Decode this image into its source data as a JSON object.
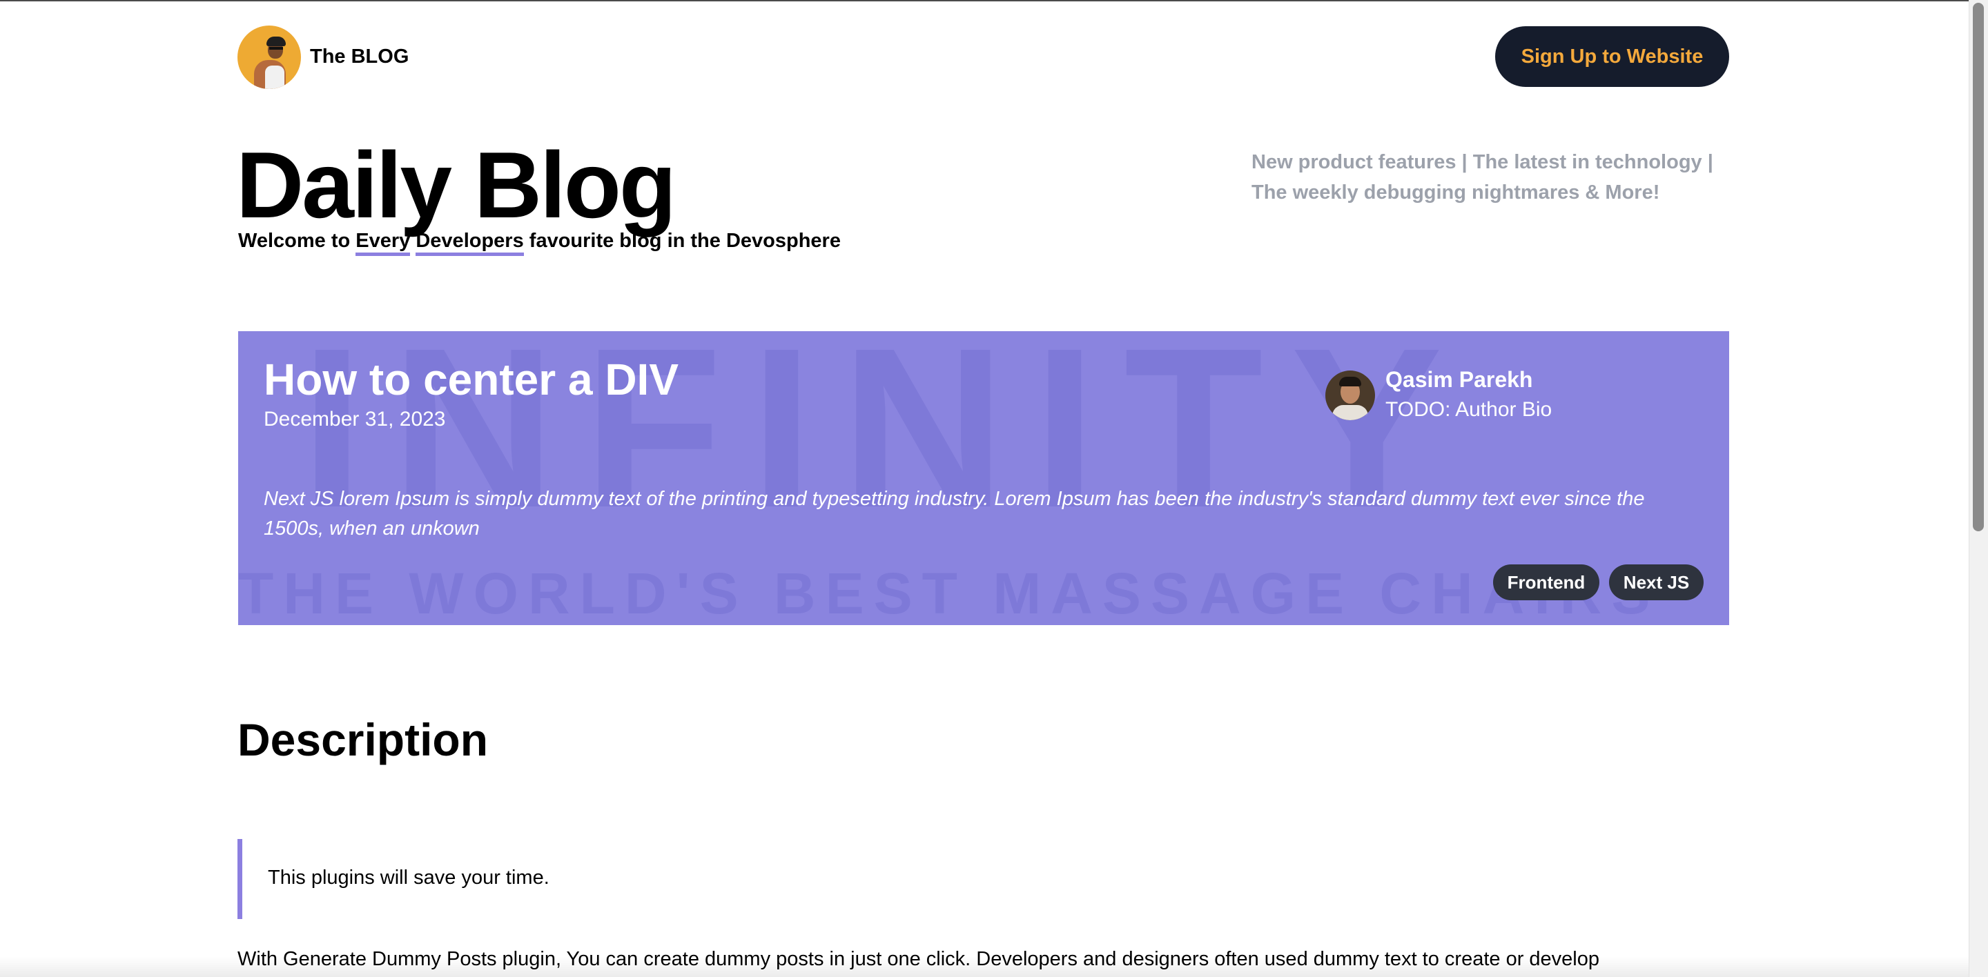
{
  "header": {
    "brand_name": "The BLOG",
    "signup_label": "Sign Up to Website"
  },
  "hero": {
    "title": "Daily Blog",
    "subtitle_parts": [
      "Welcome to ",
      "Every",
      " ",
      "Developers",
      " ",
      "favourite blog in the Devosphere"
    ],
    "tagline": "New product features | The latest in technology | The weekly debugging nightmares & More!"
  },
  "featured_post": {
    "title": "How to center a DIV",
    "date": "December 31, 2023",
    "author_name": "Qasim Parekh",
    "author_bio": "TODO: Author Bio",
    "excerpt": "Next JS lorem Ipsum is simply dummy text of the printing and typesetting industry. Lorem Ipsum has been the industry's standard dummy text ever since the 1500s, when an unkown",
    "tags": [
      "Frontend",
      "Next JS"
    ],
    "background_words": [
      "INFINITY",
      "THE WORLD'S BEST MASSAGE CHAIRS"
    ]
  },
  "content": {
    "section_heading": "Description",
    "quote": "This plugins will save your time.",
    "paragraph": "With Generate Dummy Posts plugin, You can create dummy posts in just one click. Developers and designers often used dummy text to create or develop"
  },
  "colors": {
    "accent": "#8a84df",
    "underline": "#8c7fe0",
    "button_bg": "#151c2c",
    "button_text": "#f4a93c",
    "tag_bg": "#2e333e",
    "tagline": "#9ca1ab"
  }
}
